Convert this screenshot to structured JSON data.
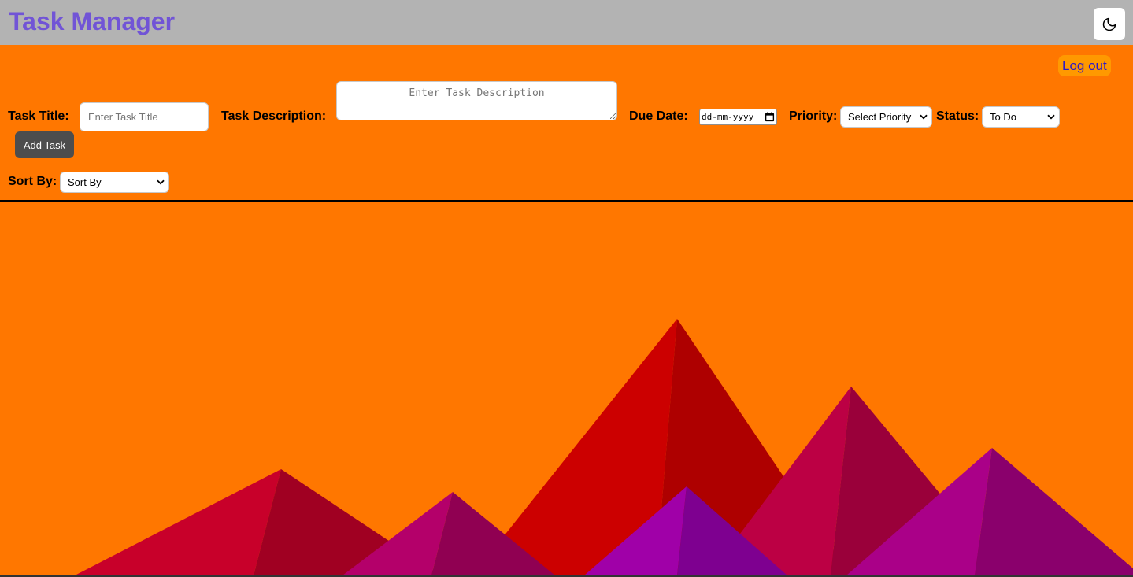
{
  "header": {
    "title": "Task Manager",
    "theme_toggle_icon": "moon-icon"
  },
  "auth": {
    "logout_label": "Log out"
  },
  "form": {
    "title_label": "Task Title:",
    "title_placeholder": "Enter Task Title",
    "description_label": "Task Description:",
    "description_placeholder": "Enter Task Description",
    "due_date_label": "Due Date:",
    "due_date_value": "dd-mm-yyyy",
    "due_date_icon": "calendar-icon",
    "priority_label": "Priority:",
    "priority_selected": "Select Priority",
    "status_label": "Status:",
    "status_selected": "To Do",
    "add_button_label": "Add Task"
  },
  "sort": {
    "label": "Sort By:",
    "selected": "Sort By"
  },
  "colors": {
    "header_bg": "#b3b3b3",
    "title": "#7154d6",
    "page_bg": "#ff7700",
    "logout_bg": "#ff9900",
    "logout_text": "#2b18c9",
    "button_bg": "#4d4d4d"
  }
}
